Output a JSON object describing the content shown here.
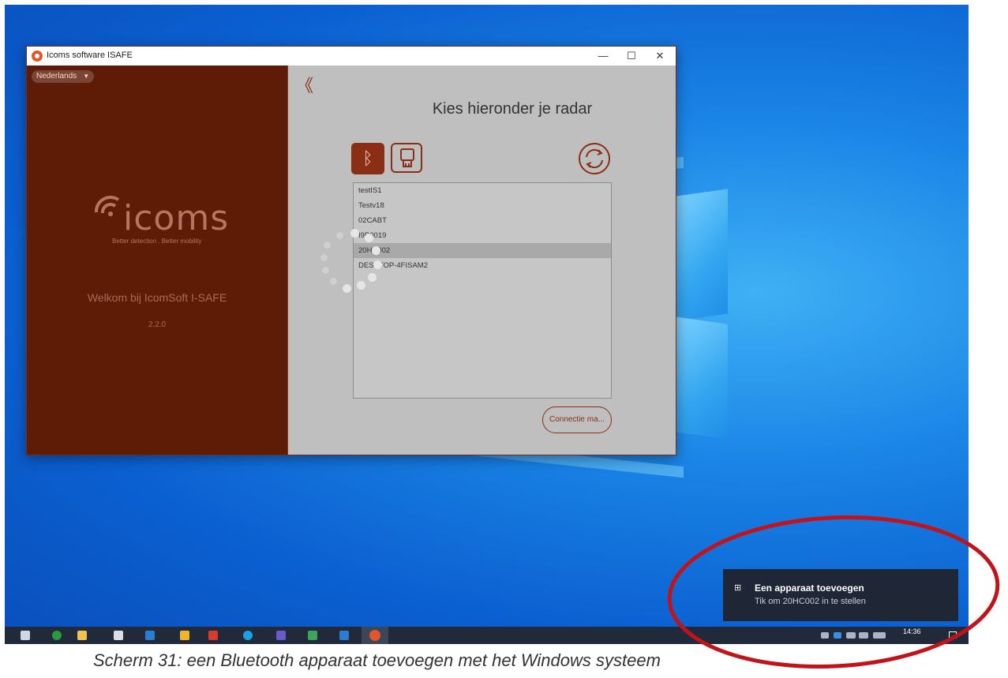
{
  "window": {
    "title": "Icoms software ISAFE",
    "minimize": "—",
    "maximize": "☐",
    "close": "✕"
  },
  "sidebar": {
    "language": "Nederlands",
    "logo_text": "icoms",
    "logo_tagline": "Better detection . Better mobility",
    "welcome": "Welkom bij IcomSoft I-SAFE",
    "version": "2.2.0"
  },
  "main": {
    "back": "《",
    "heading": "Kies hieronder je radar",
    "devices": [
      "testIS1",
      "Testv18",
      "02CABT",
      "I9P0019",
      "20HC002",
      "DESKTOP-4FISAM2"
    ],
    "selected_index": 4,
    "connect_label": "Connectie ma..."
  },
  "taskbar": {
    "time": "14:36",
    "lang": "NLD"
  },
  "toast": {
    "title": "Een apparaat toevoegen",
    "text": "Tik om 20HC002 in te stellen"
  },
  "caption": "Scherm 31: een Bluetooth apparaat toevoegen met het Windows systeem",
  "colors": {
    "accent": "#8a2f14",
    "sidebar_bg": "#5e1c07",
    "annotation": "#c0141a"
  }
}
